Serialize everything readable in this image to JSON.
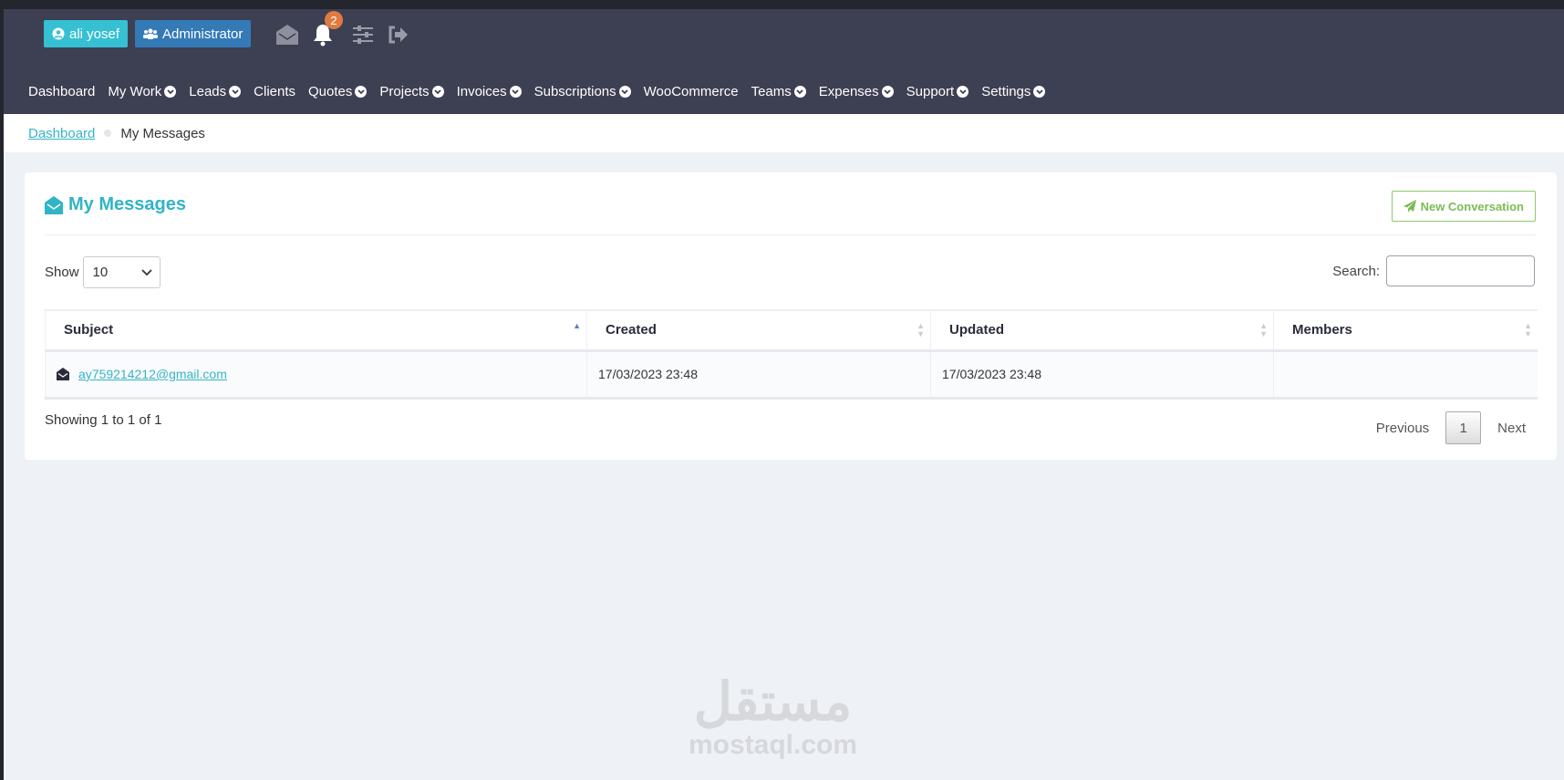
{
  "header": {
    "user": "ali yosef",
    "role": "Administrator",
    "notification_count": "2"
  },
  "nav": [
    {
      "label": "Dashboard",
      "dropdown": false
    },
    {
      "label": "My Work",
      "dropdown": true
    },
    {
      "label": "Leads",
      "dropdown": true
    },
    {
      "label": "Clients",
      "dropdown": false
    },
    {
      "label": "Quotes",
      "dropdown": true
    },
    {
      "label": "Projects",
      "dropdown": true
    },
    {
      "label": "Invoices",
      "dropdown": true
    },
    {
      "label": "Subscriptions",
      "dropdown": true
    },
    {
      "label": "WooCommerce",
      "dropdown": false
    },
    {
      "label": "Teams",
      "dropdown": true
    },
    {
      "label": "Expenses",
      "dropdown": true
    },
    {
      "label": "Support",
      "dropdown": true
    },
    {
      "label": "Settings",
      "dropdown": true
    }
  ],
  "breadcrumb": {
    "home": "Dashboard",
    "current": "My Messages"
  },
  "card": {
    "title": "My Messages",
    "new_button": "New Conversation",
    "show_label": "Show",
    "page_size": "10",
    "search_label": "Search:",
    "search_value": ""
  },
  "table": {
    "columns": [
      "Subject",
      "Created",
      "Updated",
      "Members"
    ],
    "rows": [
      {
        "subject": "ay759214212@gmail.com",
        "created": "17/03/2023 23:48",
        "updated": "17/03/2023 23:48",
        "members": ""
      }
    ]
  },
  "footer": {
    "info": "Showing 1 to 1 of 1",
    "previous": "Previous",
    "page": "1",
    "next": "Next"
  },
  "watermark": {
    "arabic": "مستقل",
    "latin": "mostaql.com"
  },
  "colors": {
    "header": "#3d3f52",
    "accent": "#2fb5c6",
    "green": "#7dbb55",
    "admin": "#337ab7"
  }
}
